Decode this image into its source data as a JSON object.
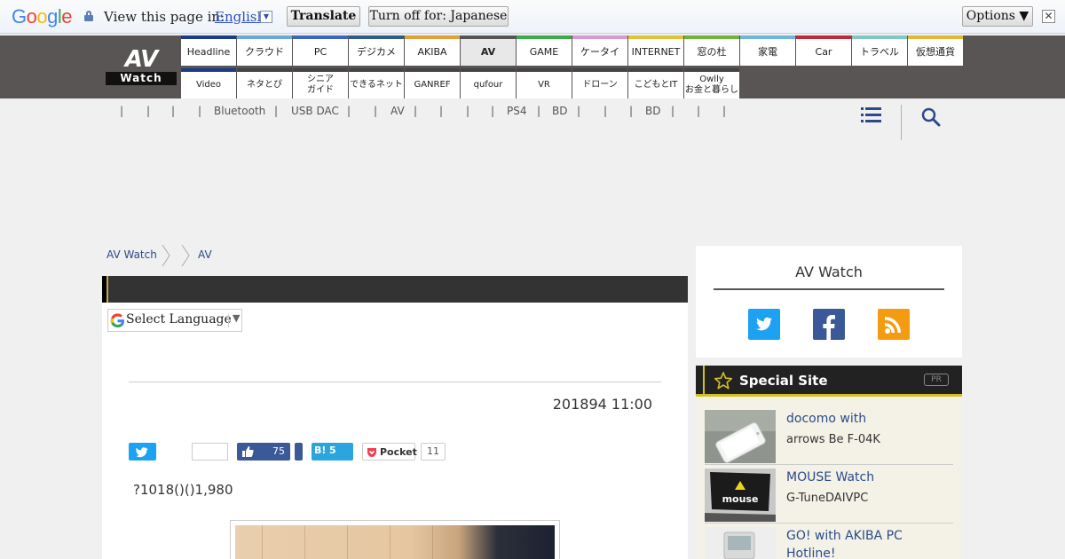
{
  "translate_bar": {
    "logo_letters": [
      "G",
      "o",
      "o",
      "g",
      "l",
      "e"
    ],
    "logo_colors": [
      "#4285f4",
      "#ea4335",
      "#fbbc05",
      "#4285f4",
      "#34a853",
      "#ea4335"
    ],
    "prompt": "View this page in:",
    "language": "English",
    "dropdown_glyph": "▼",
    "translate_button": "Translate",
    "turn_off_button": "Turn off for: Japanese",
    "options_button": "Options ▼",
    "close_glyph": "✕"
  },
  "site": {
    "logo_top": "AV",
    "logo_bottom": "Watch"
  },
  "nav": {
    "row1": [
      {
        "label": "Headline",
        "color": "#1a3c8b"
      },
      {
        "label": "クラウド",
        "color": "#6aa8d8"
      },
      {
        "label": "PC",
        "color": "#3a67c6"
      },
      {
        "label": "デジカメ",
        "color": "#2e5d86"
      },
      {
        "label": "AKIBA",
        "color": "#e0a03a"
      },
      {
        "label": "AV",
        "color": "#555555"
      },
      {
        "label": "GAME",
        "color": "#3aaa4b"
      },
      {
        "label": "ケータイ",
        "color": "#d59ad1"
      },
      {
        "label": "INTERNET",
        "color": "#e3c23a"
      },
      {
        "label": "窓の杜",
        "color": "#73b33d"
      },
      {
        "label": "家電",
        "color": "#6fb7d8"
      },
      {
        "label": "Car",
        "color": "#c0283c"
      },
      {
        "label": "トラベル",
        "color": "#7fc7c0"
      },
      {
        "label": "仮想通貨",
        "color": "#e3b63a"
      }
    ],
    "row2": [
      {
        "label": "Video",
        "color": "#1a3c8b"
      },
      {
        "label": "ネタとぴ",
        "color": "#444444"
      },
      {
        "label": "シニア\nガイド",
        "color": "#444444"
      },
      {
        "label": "できるネット",
        "color": "#444444"
      },
      {
        "label": "GANREF",
        "color": "#444444"
      },
      {
        "label": "qufour",
        "color": "#444444"
      },
      {
        "label": "VR",
        "color": "#444444"
      },
      {
        "label": "ドローン",
        "color": "#444444"
      },
      {
        "label": "こどもとIT",
        "color": "#444444"
      },
      {
        "label": "Owlly\nお金と暮らし",
        "color": "#444444"
      }
    ]
  },
  "tags": [
    "|",
    "|",
    "|",
    "|",
    "Bluetooth",
    "|",
    "USB DAC",
    "|",
    "|",
    "AV",
    "|",
    "|",
    "|",
    "|",
    "PS4",
    "|",
    "BD",
    "|",
    "|",
    "|",
    "BD",
    "|",
    "|",
    "|"
  ],
  "breadcrumb": [
    "AV Watch",
    "AV"
  ],
  "article": {
    "select_language": "Select Language",
    "select_arrow": "▼",
    "date": "201894 11:00",
    "like_count": "75",
    "hatena_label": "B!",
    "hatena_count": "5",
    "pocket_label": "Pocket",
    "pocket_count": "11",
    "lead": "?1018()()1,980"
  },
  "sidebar": {
    "title": "AV Watch",
    "social_colors": [
      "#1da1f2",
      "#3b5998",
      "#f39c12"
    ],
    "special_title": "Special Site",
    "pr_badge": "PR",
    "items": [
      {
        "link": "docomo with",
        "sub": "arrows Be F-04K"
      },
      {
        "link": "MOUSE Watch",
        "sub": "G-TuneDAIVPC"
      },
      {
        "link": "GO! with AKIBA PC Hotline!",
        "sub": ""
      }
    ]
  }
}
